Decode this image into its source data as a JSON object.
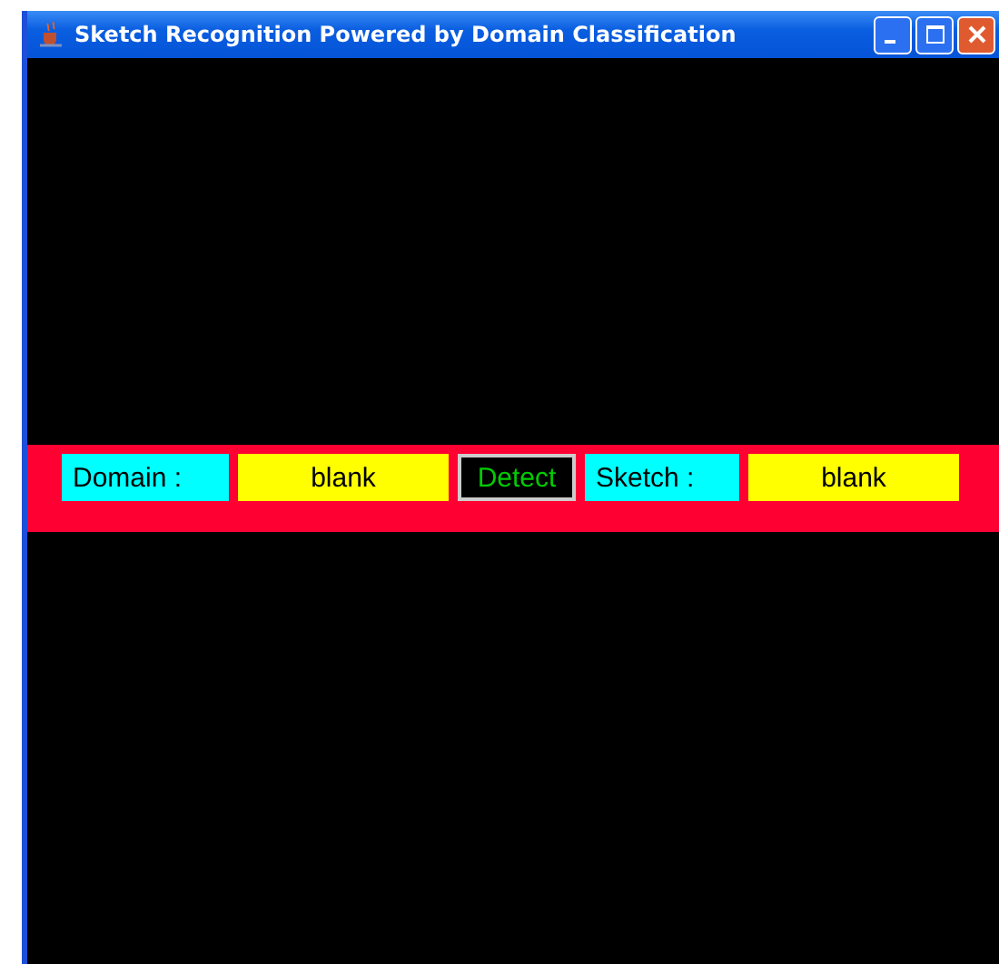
{
  "window": {
    "title": "Sketch Recognition Powered by Domain Classification"
  },
  "toolbar": {
    "domain_label": "Domain :",
    "domain_value": "blank",
    "detect_button": "Detect",
    "sketch_label": "Sketch :",
    "sketch_value": "blank"
  }
}
